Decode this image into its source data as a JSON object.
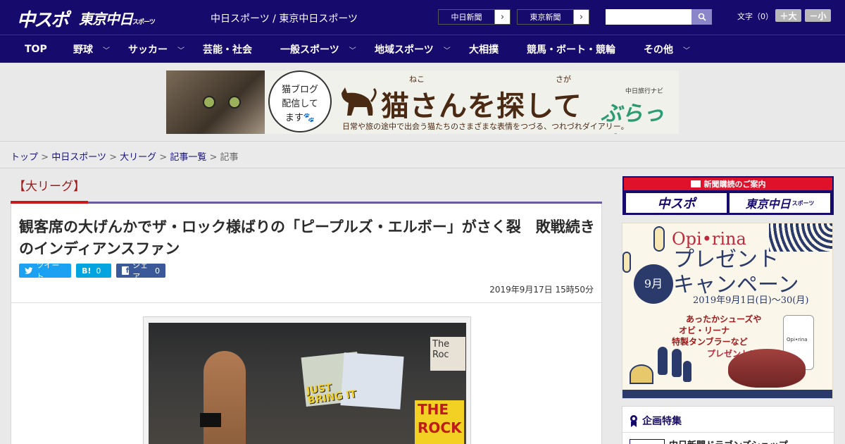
{
  "header": {
    "logo_main": "中スポ",
    "logo_tokyo": "東京中日",
    "logo_tokyo_suffix": "スポーツ",
    "subtitle": "中日スポーツ / 東京中日スポーツ",
    "paper_links": [
      "中日新聞",
      "東京新聞"
    ],
    "search_placeholder": "",
    "font_size_label": "文字（0）",
    "font_larger": "＋大",
    "font_smaller": "－小"
  },
  "nav": {
    "items": [
      {
        "label": "TOP",
        "has_menu": false
      },
      {
        "label": "野球",
        "has_menu": true
      },
      {
        "label": "サッカー",
        "has_menu": true
      },
      {
        "label": "芸能・社会",
        "has_menu": false
      },
      {
        "label": "一般スポーツ",
        "has_menu": true
      },
      {
        "label": "地域スポーツ",
        "has_menu": true
      },
      {
        "label": "大相撲",
        "has_menu": false
      },
      {
        "label": "競馬・ボート・競輪",
        "has_menu": false
      },
      {
        "label": "その他",
        "has_menu": true
      }
    ]
  },
  "banner": {
    "bubble_text": [
      "猫ブログ",
      "配信して",
      "ます🐾"
    ],
    "title": "猫さんを探して",
    "ruby_neko": "ねこ",
    "ruby_saga": "さが",
    "subtitle": "日常や旅の途中で出会う猫たちのさまざまな表情をつづる、つれづれダイアリー。",
    "brand_small": "中日旅行ナビ",
    "brand": "ぶらっ人"
  },
  "breadcrumb": {
    "items": [
      "トップ",
      "中日スポーツ",
      "大リーグ",
      "記事一覧"
    ],
    "current": "記事",
    "separator": ">"
  },
  "article": {
    "category": "【大リーグ】",
    "headline": "観客席の大げんかでザ・ロック様ばりの「ピープルズ・エルボー」がさく裂　敗戦続きのインディアンスファン",
    "share": {
      "tweet": "ツイート",
      "hatena": "B!",
      "hatena_count": "0",
      "facebook": "シェア",
      "facebook_count": "0"
    },
    "date": "2019年9月17日 15時50分",
    "photo_signs": [
      "JUST BRING IT",
      "THE ROCK",
      "The Roc"
    ]
  },
  "sidebar": {
    "subscribe_head": "新聞購読のご案内",
    "subscribe_buttons": [
      "中スポ",
      "東京中日"
    ],
    "subscribe_suffix": "スポーツ",
    "campaign": {
      "brand": "Opi•rina",
      "title_line1": "プレゼント",
      "title_line2": "キャンペーン",
      "month": "9月",
      "dates": "2019年9月1日(日)〜30(月)",
      "prize_line1": "あったかシューズや",
      "prize_line2": "オビ・リーナ",
      "prize_line3": "特製タンブラーなど",
      "present": "プレゼント!!",
      "tumbler_text": "Opi•rina"
    },
    "feature": {
      "title": "企画特集",
      "first_item": "中日新聞ドラゴンズショップ"
    }
  },
  "colors": {
    "brand_navy": "#170a6d",
    "accent_red": "#c81a1a",
    "twitter": "#1da1f2",
    "hatena": "#00a4de",
    "facebook": "#3b5998"
  }
}
